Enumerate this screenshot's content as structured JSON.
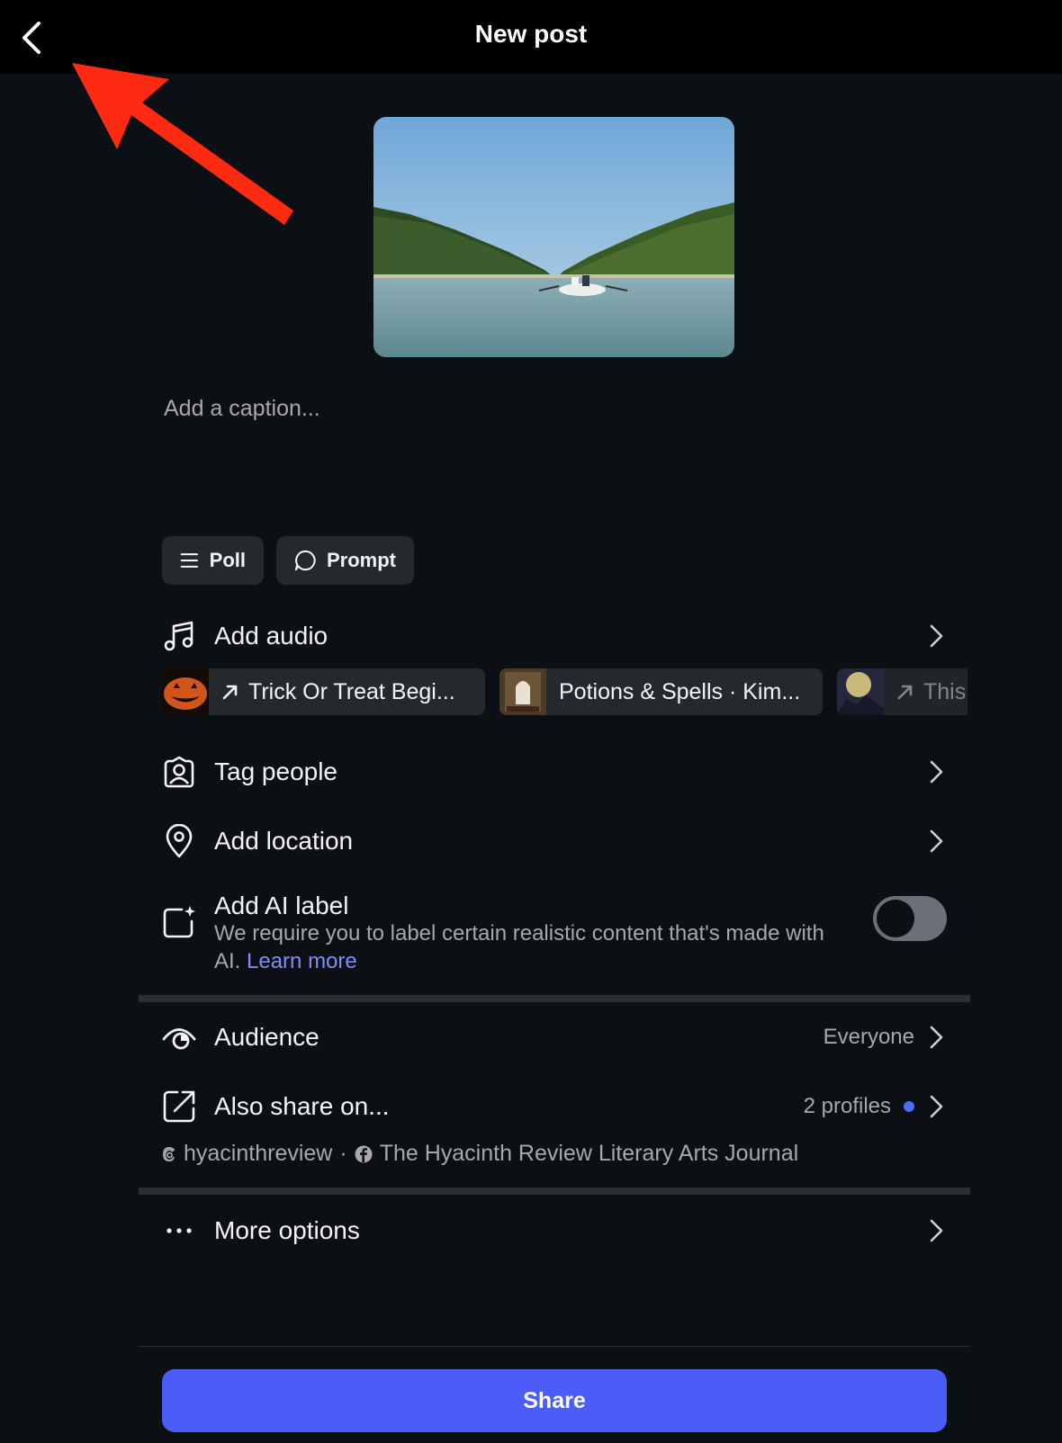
{
  "header": {
    "title": "New post",
    "back_icon": "chevron-left-icon"
  },
  "caption": {
    "placeholder": "Add a caption..."
  },
  "chips": [
    {
      "label": "Poll",
      "icon": "list-icon"
    },
    {
      "label": "Prompt",
      "icon": "speech-bubble-icon"
    }
  ],
  "audio": {
    "label": "Add audio",
    "suggestions": [
      {
        "title": "Trick Or Treat Begi...",
        "trending": true
      },
      {
        "title": "Potions & Spells · Kim...",
        "trending": false
      },
      {
        "title": "This",
        "trending": true
      }
    ]
  },
  "tag_people": {
    "label": "Tag people"
  },
  "location": {
    "label": "Add location"
  },
  "ai_label": {
    "label": "Add AI label",
    "description": "We require you to label certain realistic content that's made with AI.",
    "learn_more": "Learn more",
    "enabled": false
  },
  "audience": {
    "label": "Audience",
    "value": "Everyone"
  },
  "also_share": {
    "label": "Also share on...",
    "value": "2 profiles",
    "accounts": {
      "threads": "hyacinthreview",
      "separator": "·",
      "facebook": "The Hyacinth Review Literary Arts Journal"
    }
  },
  "more_options": {
    "label": "More options"
  },
  "share_button": {
    "label": "Share"
  },
  "colors": {
    "accent": "#4a5df9",
    "link": "#818cf8",
    "annotation_arrow": "#ff2a12",
    "background": "#0c1014"
  }
}
